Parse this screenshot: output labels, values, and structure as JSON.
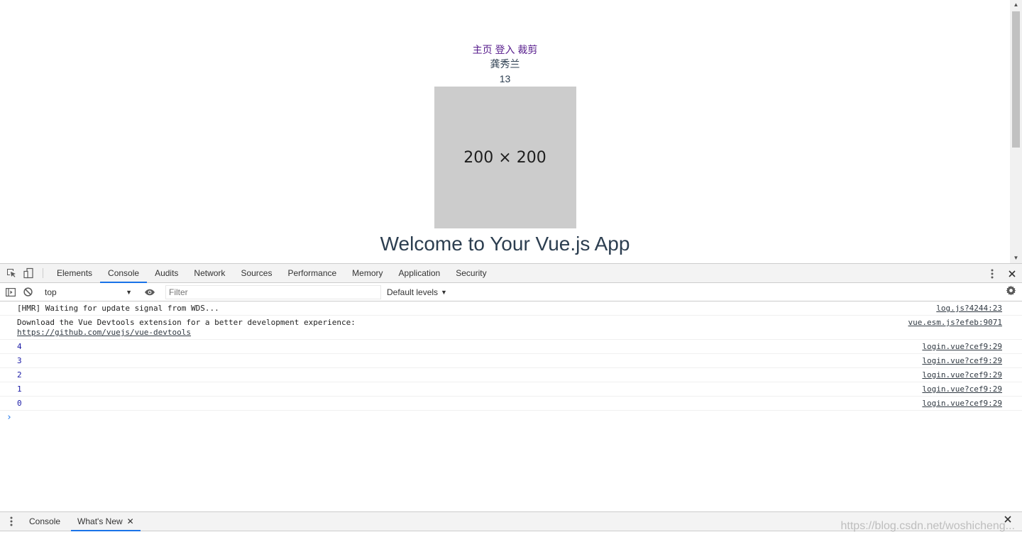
{
  "page": {
    "nav": [
      "主页",
      "登入",
      "裁剪"
    ],
    "name": "龚秀兰",
    "number": "13",
    "placeholder_label": "200 × 200",
    "welcome": "Welcome to Your Vue.js App"
  },
  "devtools": {
    "tabs": [
      "Elements",
      "Console",
      "Audits",
      "Network",
      "Sources",
      "Performance",
      "Memory",
      "Application",
      "Security"
    ],
    "active_tab": "Console",
    "context": "top",
    "filter_placeholder": "Filter",
    "levels": "Default levels",
    "messages": [
      {
        "text": "[HMR] Waiting for update signal from WDS...",
        "source": "log.js?4244:23"
      },
      {
        "text": "Download the Vue Devtools extension for a better development experience:",
        "link": "https://github.com/vuejs/vue-devtools",
        "source": "vue.esm.js?efeb:9071"
      },
      {
        "text": "4",
        "source": "login.vue?cef9:29"
      },
      {
        "text": "3",
        "source": "login.vue?cef9:29"
      },
      {
        "text": "2",
        "source": "login.vue?cef9:29"
      },
      {
        "text": "1",
        "source": "login.vue?cef9:29"
      },
      {
        "text": "0",
        "source": "login.vue?cef9:29"
      }
    ],
    "prompt": "›",
    "drawer_tabs": [
      "Console",
      "What's New"
    ],
    "accent_color": "#1a73e8"
  },
  "watermark": "https://blog.csdn.net/woshicheng..."
}
